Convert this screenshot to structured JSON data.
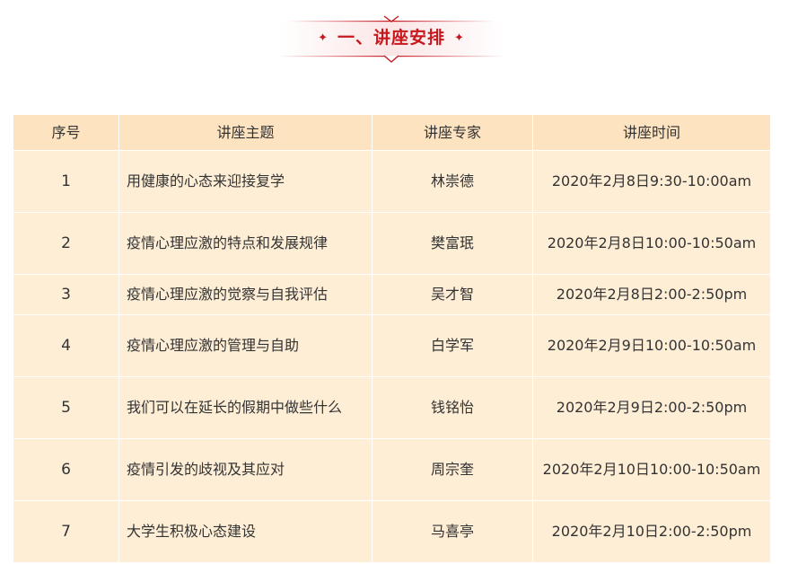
{
  "section": {
    "title": "一、讲座安排",
    "accent_color": "#c8161d"
  },
  "table": {
    "header_bg": "#fde3bf",
    "row_bg": "#feeed6",
    "headers": {
      "index": "序号",
      "topic": "讲座主题",
      "expert": "讲座专家",
      "time": "讲座时间"
    },
    "rows": [
      {
        "index": "1",
        "topic": "用健康的心态来迎接复学",
        "expert": "林崇德",
        "time": "2020年2月8日9:30-10:00am"
      },
      {
        "index": "2",
        "topic": "疫情心理应激的特点和发展规律",
        "expert": "樊富珉",
        "time": "2020年2月8日10:00-10:50am"
      },
      {
        "index": "3",
        "topic": "疫情心理应激的觉察与自我评估",
        "expert": "吴才智",
        "time": "2020年2月8日2:00-2:50pm"
      },
      {
        "index": "4",
        "topic": "疫情心理应激的管理与自助",
        "expert": "白学军",
        "time": "2020年2月9日10:00-10:50am"
      },
      {
        "index": "5",
        "topic": "我们可以在延长的假期中做些什么",
        "expert": "钱铭怡",
        "time": "2020年2月9日2:00-2:50pm"
      },
      {
        "index": "6",
        "topic": "疫情引发的歧视及其应对",
        "expert": "周宗奎",
        "time": "2020年2月10日10:00-10:50am"
      },
      {
        "index": "7",
        "topic": "大学生积极心态建设",
        "expert": "马喜亭",
        "time": "2020年2月10日2:00-2:50pm"
      }
    ]
  }
}
